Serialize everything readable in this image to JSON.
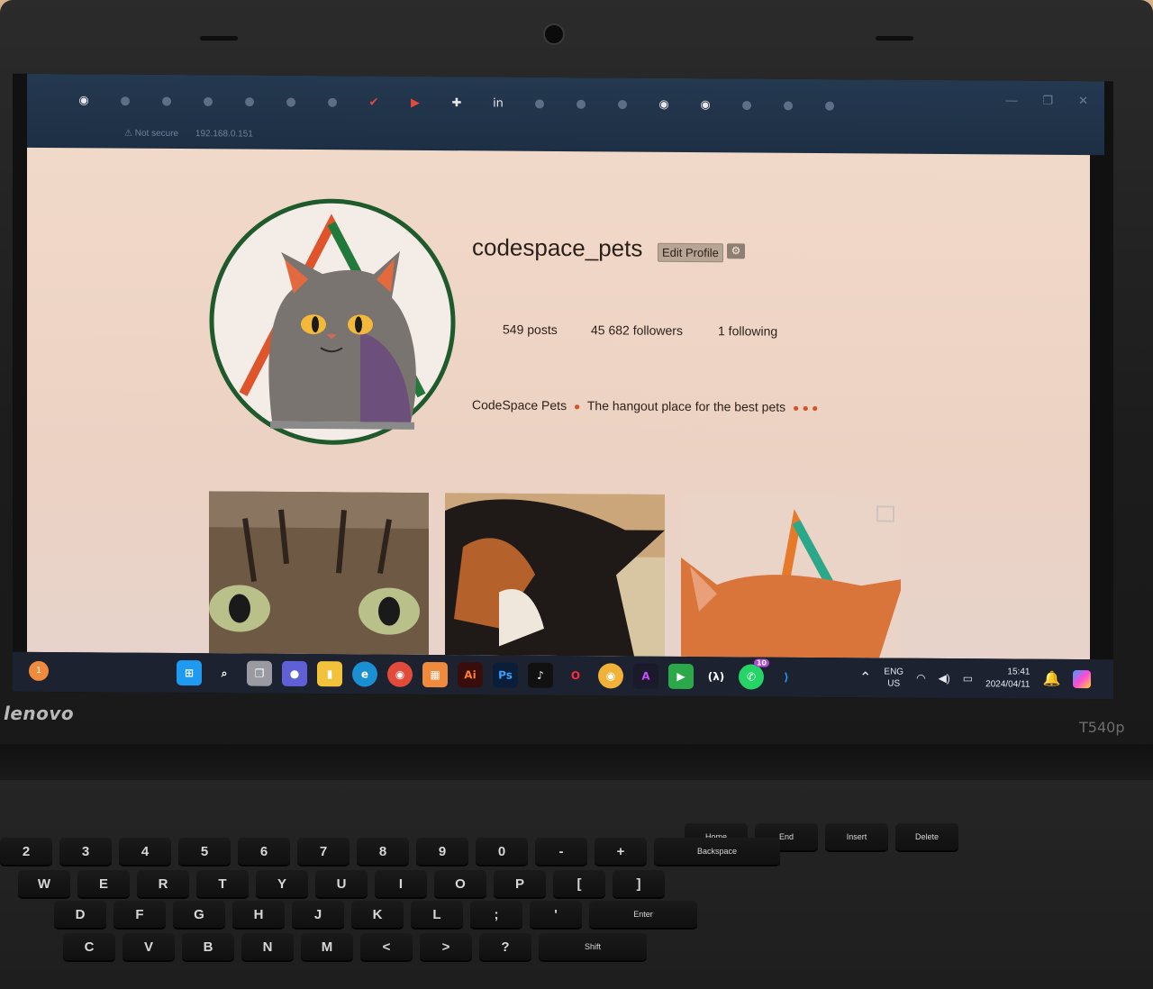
{
  "device": {
    "brand": "lenovo",
    "model": "T540p"
  },
  "browser": {
    "address_warning": "Not secure",
    "address_host": "192.168.0.151",
    "tabs": [
      "github-icon",
      "tab",
      "tab",
      "tab",
      "tab",
      "tab",
      "tab",
      "check-icon",
      "youtube-icon",
      "plus-icon",
      "linkedin-icon",
      "tab",
      "tab",
      "tab",
      "github-icon",
      "github-icon",
      "tab",
      "tab",
      "tab"
    ]
  },
  "profile": {
    "username": "codespace_pets",
    "edit_label": "Edit Profile",
    "gear_icon": "⚙",
    "posts": "549 posts",
    "followers": "45 682 followers",
    "following": "1 following",
    "bio_name": "CodeSpace Pets",
    "bio_text": "The hangout place for the best pets"
  },
  "taskbar": {
    "notification_badge": "1",
    "whatsapp_badge": "10",
    "lang_line1": "ENG",
    "lang_line2": "US",
    "time": "15:41",
    "date": "2024/04/11"
  },
  "keyboard": {
    "row_numbers": [
      "2",
      "3",
      "4",
      "5",
      "6",
      "7",
      "8",
      "9",
      "0",
      "-",
      "+",
      "Backspace"
    ],
    "row_top": [
      "W",
      "E",
      "R",
      "T",
      "Y",
      "U",
      "I",
      "O",
      "P",
      "[",
      "]"
    ],
    "row_home": [
      "D",
      "F",
      "G",
      "H",
      "J",
      "K",
      "L",
      ";",
      "'",
      "Enter"
    ],
    "row_bottom": [
      "C",
      "V",
      "B",
      "N",
      "M",
      "<",
      ">",
      "?",
      "Shift"
    ],
    "row_fn": [
      "Home",
      "End",
      "Insert",
      "Delete"
    ]
  },
  "colors": {
    "page_bg": "#f1d9c9",
    "logo_orange": "#e0542c",
    "logo_green": "#1f7a3c",
    "logo_teal": "#2aa88a"
  }
}
